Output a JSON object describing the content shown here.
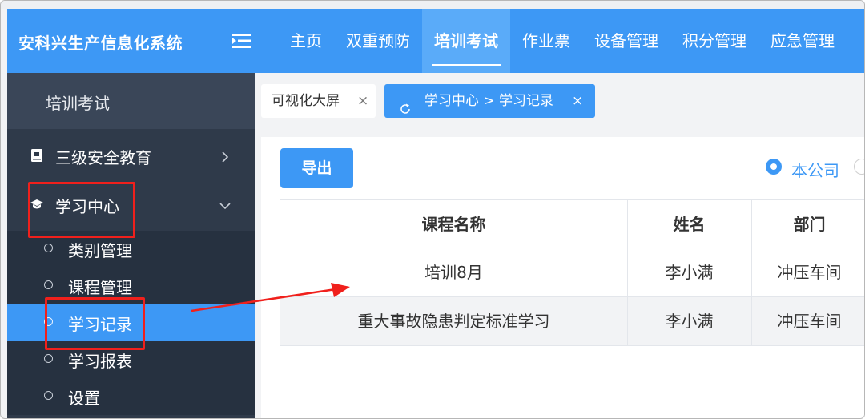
{
  "app": {
    "title": "安科兴生产信息化系统"
  },
  "nav": {
    "items": [
      {
        "label": "主页",
        "active": false
      },
      {
        "label": "双重预防",
        "active": false
      },
      {
        "label": "培训考试",
        "active": true
      },
      {
        "label": "作业票",
        "active": false
      },
      {
        "label": "设备管理",
        "active": false
      },
      {
        "label": "积分管理",
        "active": false
      },
      {
        "label": "应急管理",
        "active": false
      }
    ]
  },
  "sidebar": {
    "title": "培训考试",
    "menus": [
      {
        "label": "三级安全教育",
        "icon": "book-icon",
        "expanded": false
      },
      {
        "label": "学习中心",
        "icon": "graduation-cap-icon",
        "expanded": true
      }
    ],
    "submenu": [
      {
        "label": "类别管理",
        "active": false
      },
      {
        "label": "课程管理",
        "active": false
      },
      {
        "label": "学习记录",
        "active": true
      },
      {
        "label": "学习报表",
        "active": false
      },
      {
        "label": "设置",
        "active": false
      }
    ]
  },
  "tabs": [
    {
      "label": "可视化大屏",
      "close": "×"
    },
    {
      "label": "学习中心 > 学习记录",
      "close": "×",
      "active": true
    }
  ],
  "toolbar": {
    "export_label": "导出"
  },
  "filter": {
    "selected_label": "本公司"
  },
  "table": {
    "headers": [
      "课程名称",
      "姓名",
      "部门"
    ],
    "rows": [
      [
        "培训8月",
        "李小满",
        "冲压车间"
      ],
      [
        "重大事故隐患判定标准学习",
        "李小满",
        "冲压车间"
      ]
    ]
  },
  "colors": {
    "primary": "#3d98f5",
    "sidebar_bg": "#2f3a4a",
    "annotation_red": "#f0201c"
  }
}
